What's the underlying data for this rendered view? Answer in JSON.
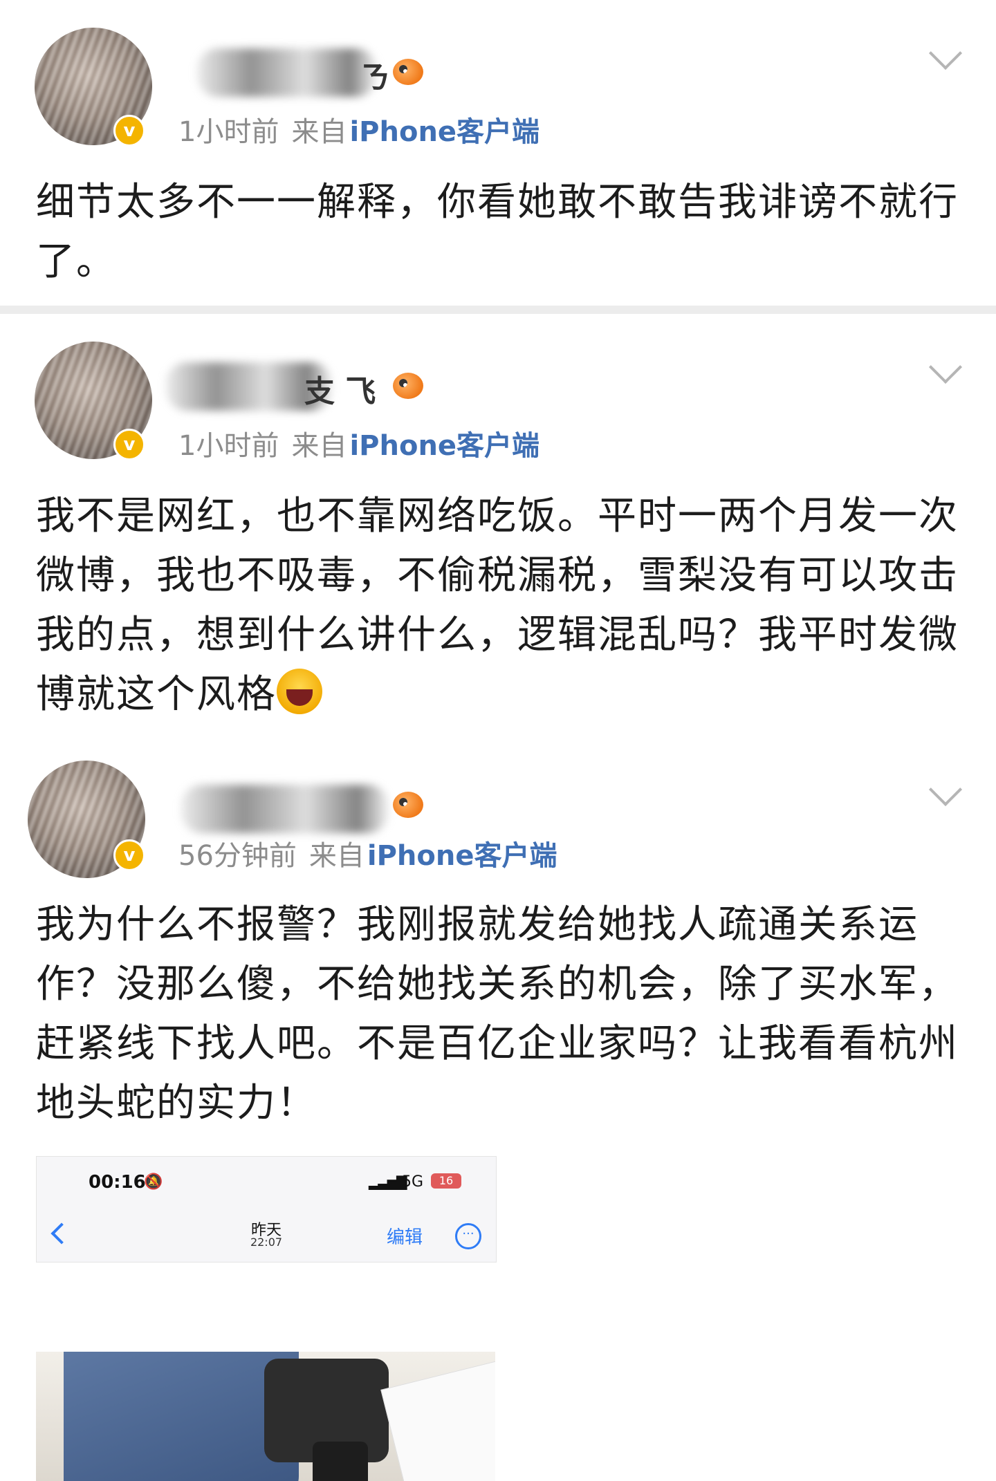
{
  "posts": [
    {
      "time": "1小时前",
      "source_prefix": "来自",
      "source": "iPhone客户端",
      "name_visible": "ㄋ",
      "content": "细节太多不一一解释，你看她敢不敢告我诽谤不就行了。"
    },
    {
      "time": "1小时前",
      "source_prefix": "来自",
      "source": "iPhone客户端",
      "name_visible": "支 飞",
      "content": "我不是网红，也不靠网络吃饭。平时一两个月发一次微博，我也不吸毒，不偷税漏税，雪梨没有可以攻击我的点，想到什么讲什么，逻辑混乱吗？我平时发微博就这个风格"
    },
    {
      "time": "56分钟前",
      "source_prefix": "来自",
      "source": "iPhone客户端",
      "name_visible": "",
      "content": "我为什么不报警？我刚报就发给她找人疏通关系运作？没那么傻，不给她找关系的机会，除了买水军，赶紧线下找人吧。不是百亿企业家吗？让我看看杭州地头蛇的实力！"
    }
  ],
  "embedded_screenshot": {
    "clock": "00:16",
    "network": "5G",
    "battery": "16",
    "title": "昨天",
    "subtitle": "22:07",
    "edit_label": "编辑"
  },
  "icons": {
    "verified": "verified-badge-icon",
    "member": "fish-member-icon",
    "more": "chevron-down-icon",
    "emoji": "laughing-emoji-icon"
  },
  "colors": {
    "source_link": "#3f6fb4",
    "meta_gray": "#8c8c8c",
    "badge_gold": "#f4b400",
    "ios_blue": "#2f7cf6"
  }
}
